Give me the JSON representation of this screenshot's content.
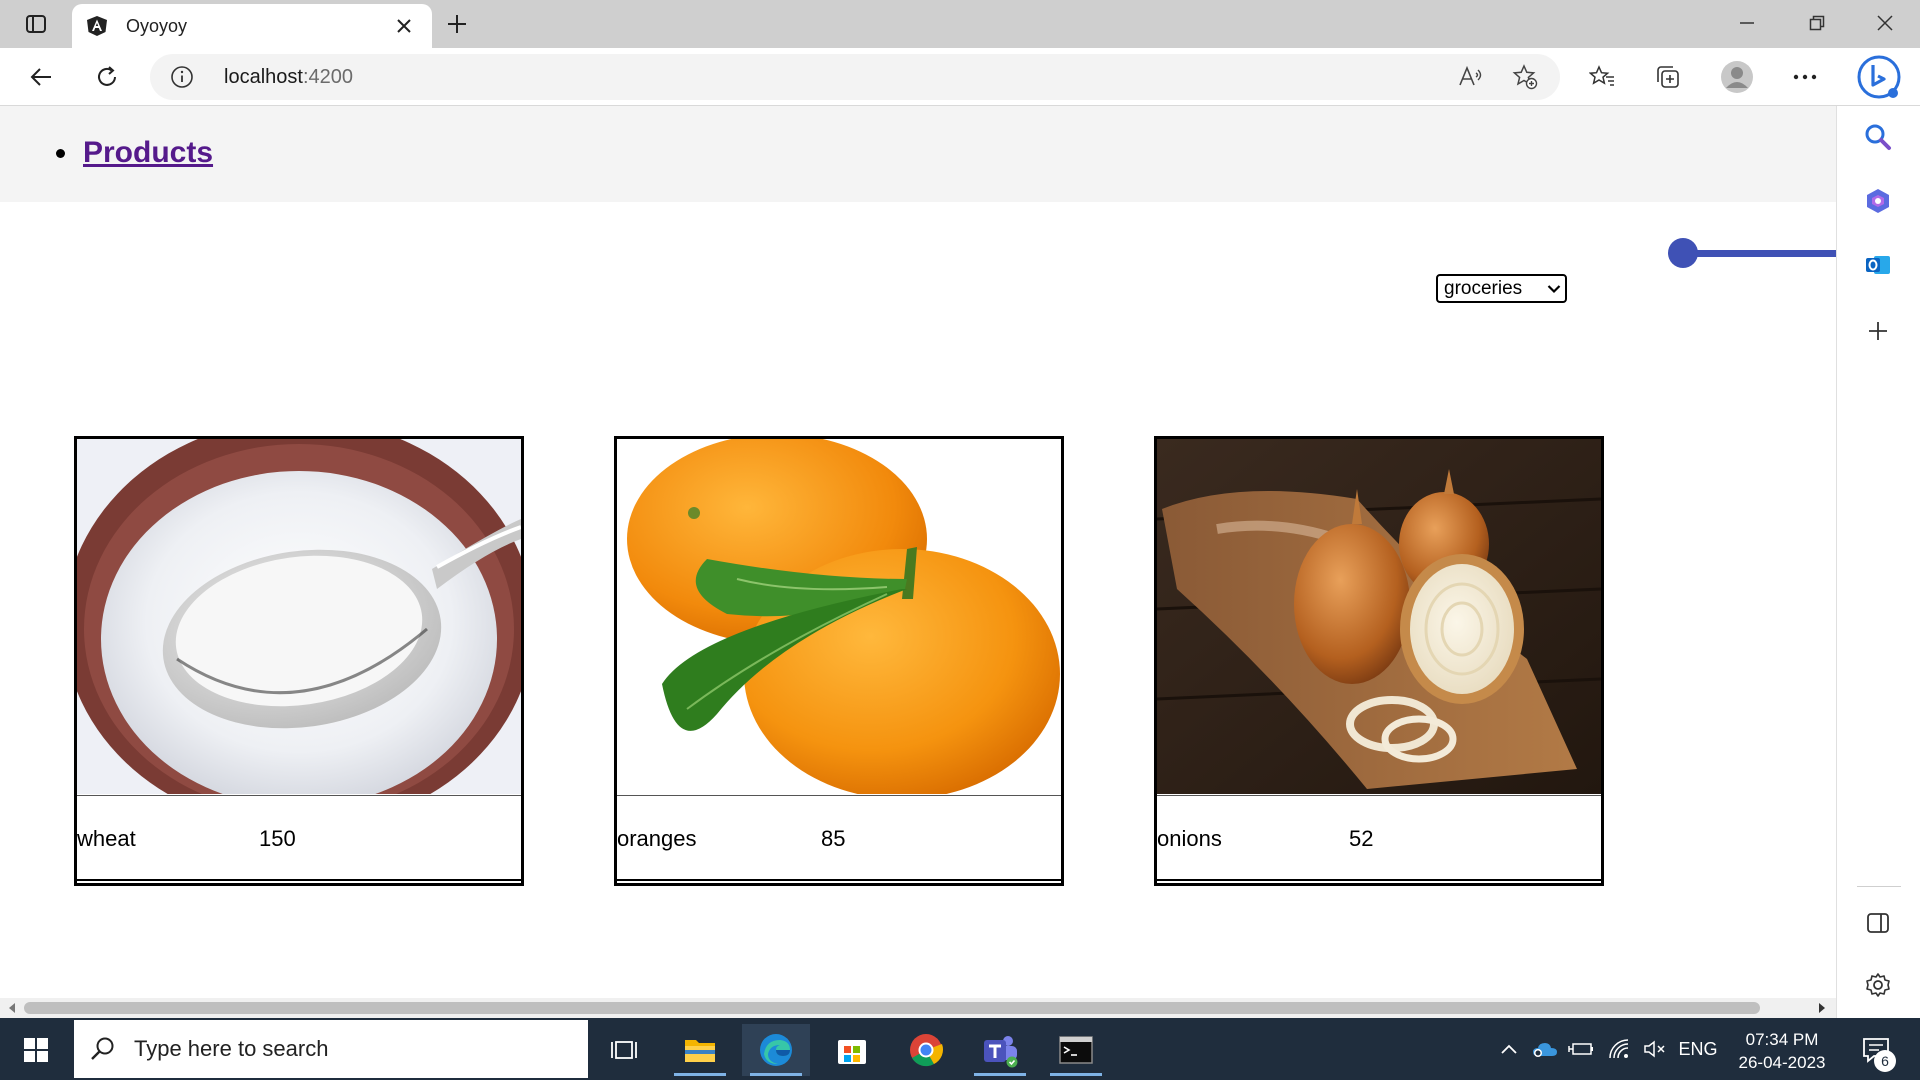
{
  "browser": {
    "tab": {
      "title": "Oyoyoy"
    },
    "address": {
      "host": "localhost",
      "port": ":4200"
    }
  },
  "page": {
    "nav": {
      "items": [
        {
          "label": "Products"
        }
      ]
    },
    "category_select": {
      "value": "groceries"
    },
    "slider": {
      "value_fraction": 0
    },
    "products": [
      {
        "name": "wheat",
        "price": "150",
        "image": "sugar-spoon-bowl-photo"
      },
      {
        "name": "oranges",
        "price": "85",
        "image": "oranges-with-leaves-photo"
      },
      {
        "name": "onions",
        "price": "52",
        "image": "onions-on-cutting-board-photo"
      }
    ]
  },
  "taskbar": {
    "search_placeholder": "Type here to search",
    "language": "ENG",
    "time": "07:34 PM",
    "date": "26-04-2023",
    "notification_count": "6"
  },
  "colors": {
    "accent": "#3f51b5",
    "link": "#551a8b",
    "taskbar": "#1f2d3d",
    "titlebar": "#cfcfcf"
  }
}
